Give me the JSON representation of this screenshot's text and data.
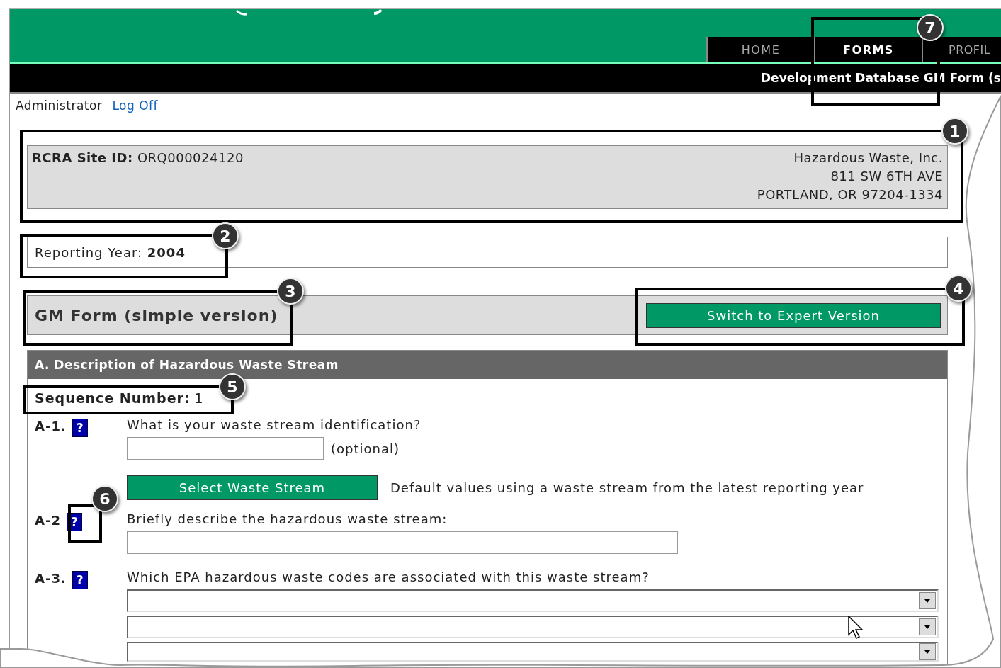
{
  "header": {
    "tabs": [
      {
        "label": "HOME",
        "selected": false
      },
      {
        "label": "FORMS",
        "selected": true
      },
      {
        "label": "PROFIL",
        "selected": false
      }
    ],
    "title_bar": "Development Database GM Form (s"
  },
  "user": {
    "name": "Administrator",
    "logoff": "Log Off"
  },
  "site": {
    "label": "RCRA Site ID:",
    "id": "ORQ000024120",
    "address": [
      "Hazardous Waste, Inc.",
      "811 SW 6TH AVE",
      "PORTLAND, OR 97204-1334"
    ]
  },
  "reporting_year": {
    "label": "Reporting Year:",
    "value": "2004"
  },
  "form_header": {
    "title": "GM Form (simple version)",
    "button": "Switch to Expert Version"
  },
  "section": {
    "title": "A. Description of Hazardous Waste Stream",
    "sequence_label": "Sequence Number:",
    "sequence_value": "1",
    "items": [
      {
        "kind": "question",
        "number": "A-1.",
        "help": "?",
        "text": "What is your waste stream identification?",
        "fields": [
          {
            "kind": "short_text",
            "note": "(optional)"
          }
        ]
      },
      {
        "kind": "action",
        "button": "Select Waste Stream",
        "text": "Default values using a waste stream from the latest reporting year"
      },
      {
        "kind": "question",
        "number": "A-2",
        "help": "?",
        "text": "Briefly describe the hazardous waste stream:",
        "fields": [
          {
            "kind": "long_text"
          }
        ]
      },
      {
        "kind": "question",
        "number": "A-3.",
        "help": "?",
        "text": "Which EPA hazardous waste codes are associated with this waste stream?",
        "fields": [
          {
            "kind": "dropdown"
          },
          {
            "kind": "dropdown"
          },
          {
            "kind": "dropdown"
          }
        ]
      }
    ]
  },
  "callouts": [
    {
      "number": "7"
    },
    {
      "number": "1"
    },
    {
      "number": "2"
    },
    {
      "number": "3"
    },
    {
      "number": "4"
    },
    {
      "number": "5"
    },
    {
      "number": "6"
    }
  ]
}
